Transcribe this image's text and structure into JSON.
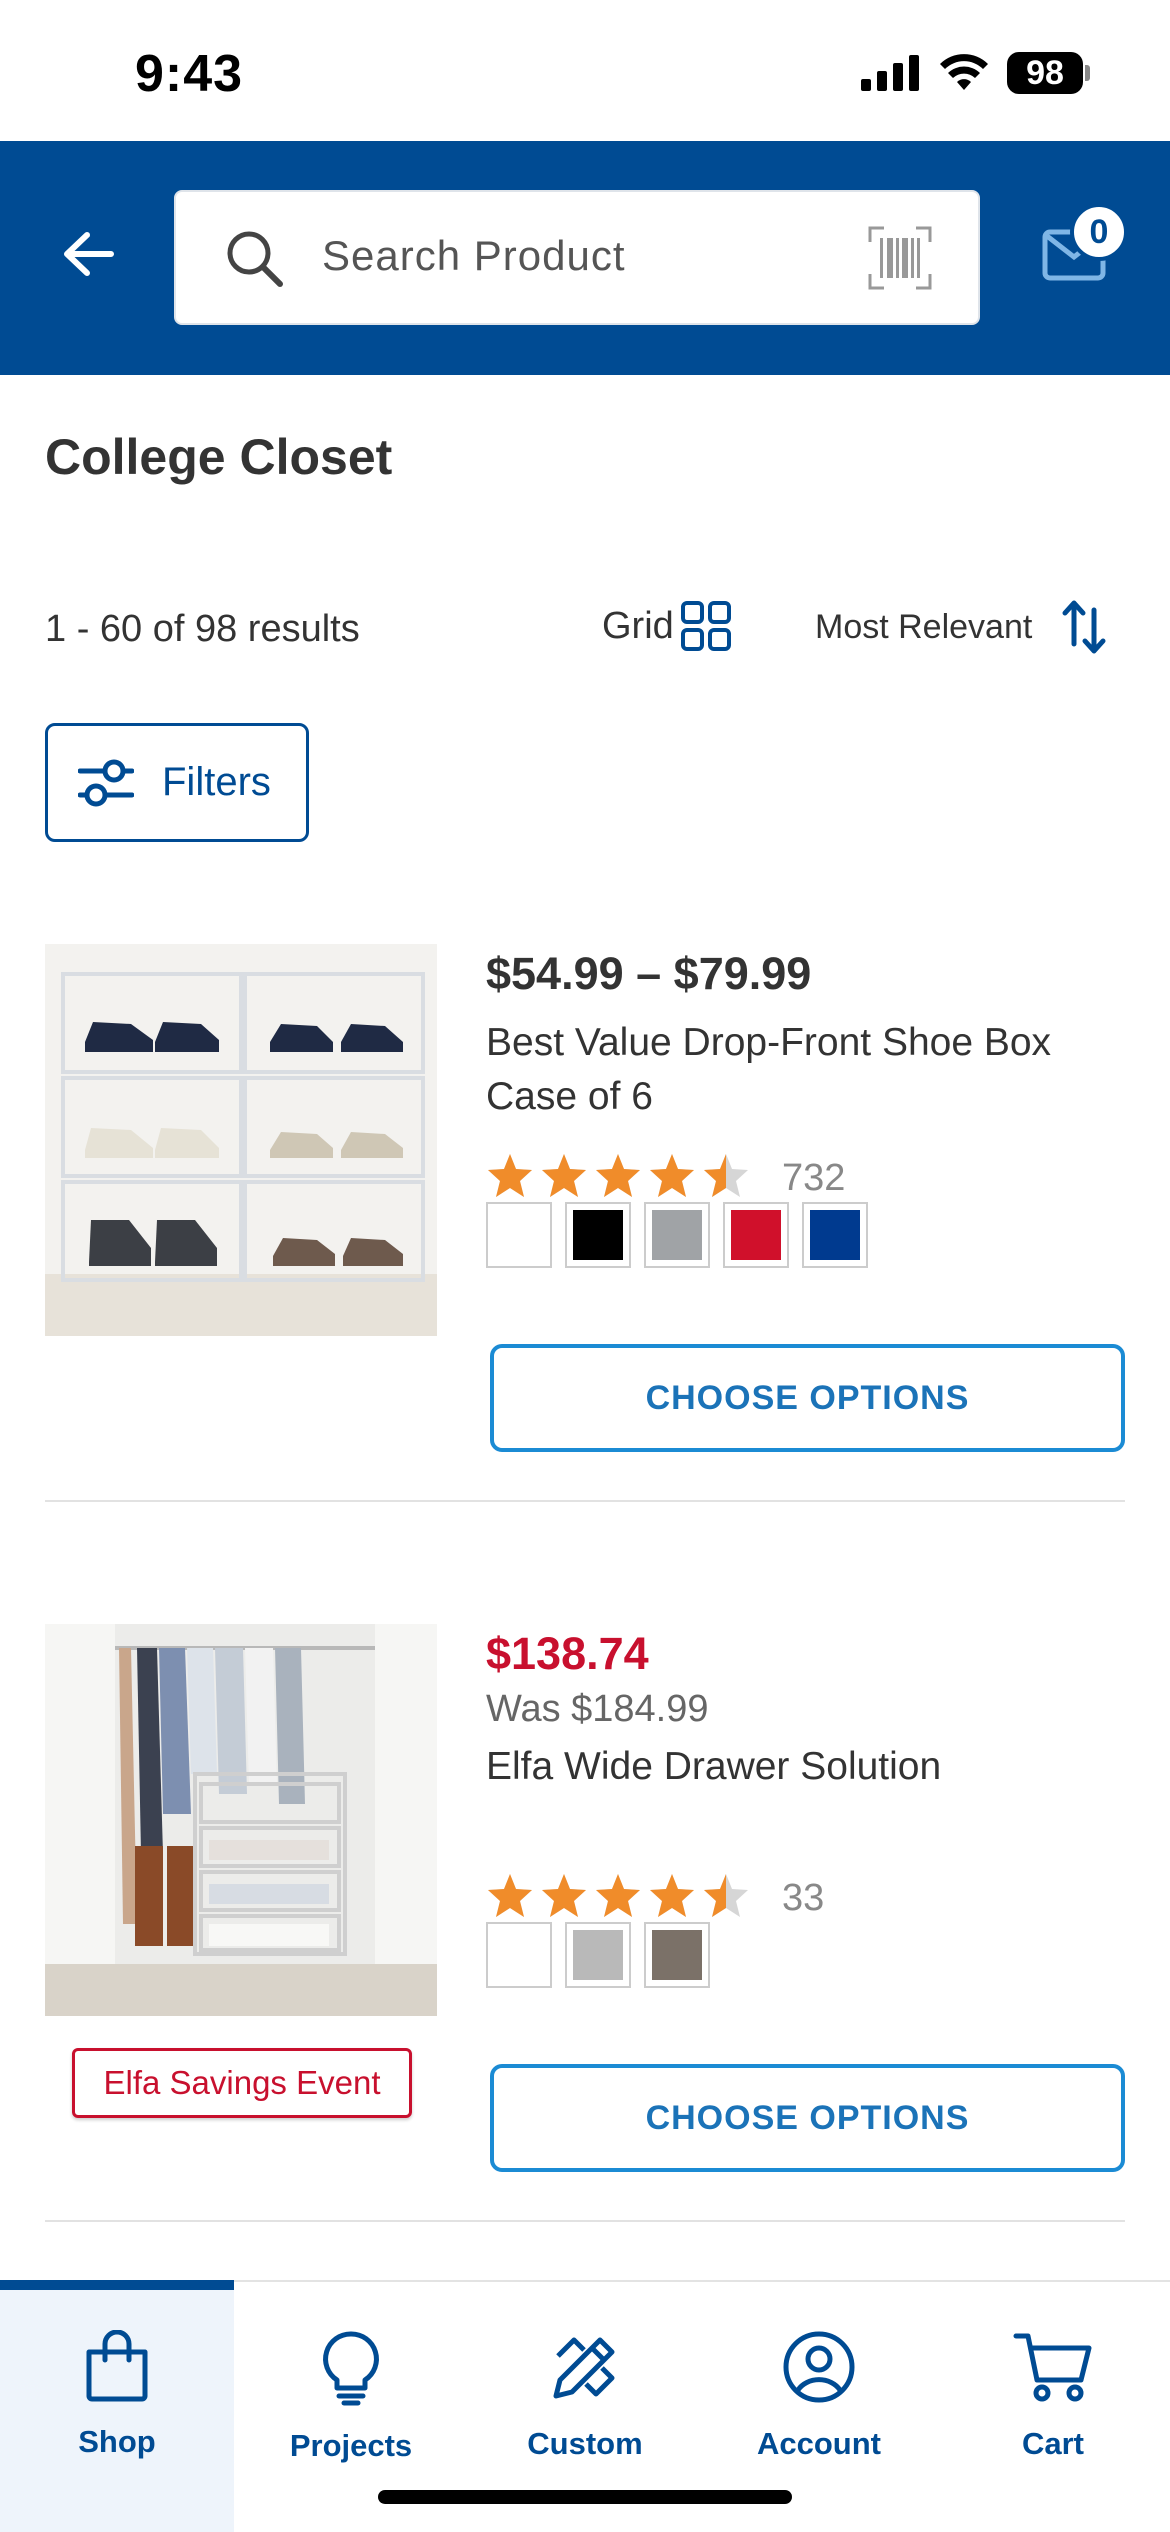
{
  "status_bar": {
    "time": "9:43",
    "battery": "98",
    "icons": [
      "cellular-signal-icon",
      "wifi-icon",
      "battery-icon"
    ]
  },
  "header": {
    "back_icon": "arrow-left-icon",
    "search": {
      "placeholder": "Search Product",
      "icon": "search-icon",
      "scan_icon": "barcode-scan-icon"
    },
    "mail_icon": "mail-icon",
    "mail_badge": "0",
    "background_color": "#004b93"
  },
  "page": {
    "title": "College Closet",
    "results_count": "1 - 60 of 98 results",
    "view_label": "Grid",
    "sort_label": "Most Relevant",
    "filters_label": "Filters"
  },
  "products": [
    {
      "price": "$54.99 – $79.99",
      "name": "Best Value Drop-Front Shoe Box Case of 6",
      "rating": 4.5,
      "review_count": "732",
      "swatches": [
        "#ffffff",
        "#000000",
        "#a0a3a6",
        "#d0102b",
        "#003a8f"
      ],
      "button_label": "CHOOSE OPTIONS"
    },
    {
      "sale_price": "$138.74",
      "was_price": "Was $184.99",
      "name": "Elfa Wide Drawer Solution",
      "rating": 4.5,
      "review_count": "33",
      "swatches": [
        "#ffffff",
        "#b9b9b9",
        "#7b7168"
      ],
      "promo": "Elfa Savings Event",
      "button_label": "CHOOSE OPTIONS"
    }
  ],
  "tab_bar": {
    "tabs": [
      {
        "label": "Shop",
        "icon": "shopping-bag-icon",
        "active": true
      },
      {
        "label": "Projects",
        "icon": "lightbulb-icon",
        "active": false
      },
      {
        "label": "Custom",
        "icon": "pencil-ruler-icon",
        "active": false
      },
      {
        "label": "Account",
        "icon": "user-circle-icon",
        "active": false
      },
      {
        "label": "Cart",
        "icon": "cart-icon",
        "active": false
      }
    ]
  },
  "colors": {
    "brand_blue": "#004b93",
    "button_outline": "#1b8bd4",
    "sale_red": "#c8102e",
    "star_orange": "#f08c2a"
  }
}
